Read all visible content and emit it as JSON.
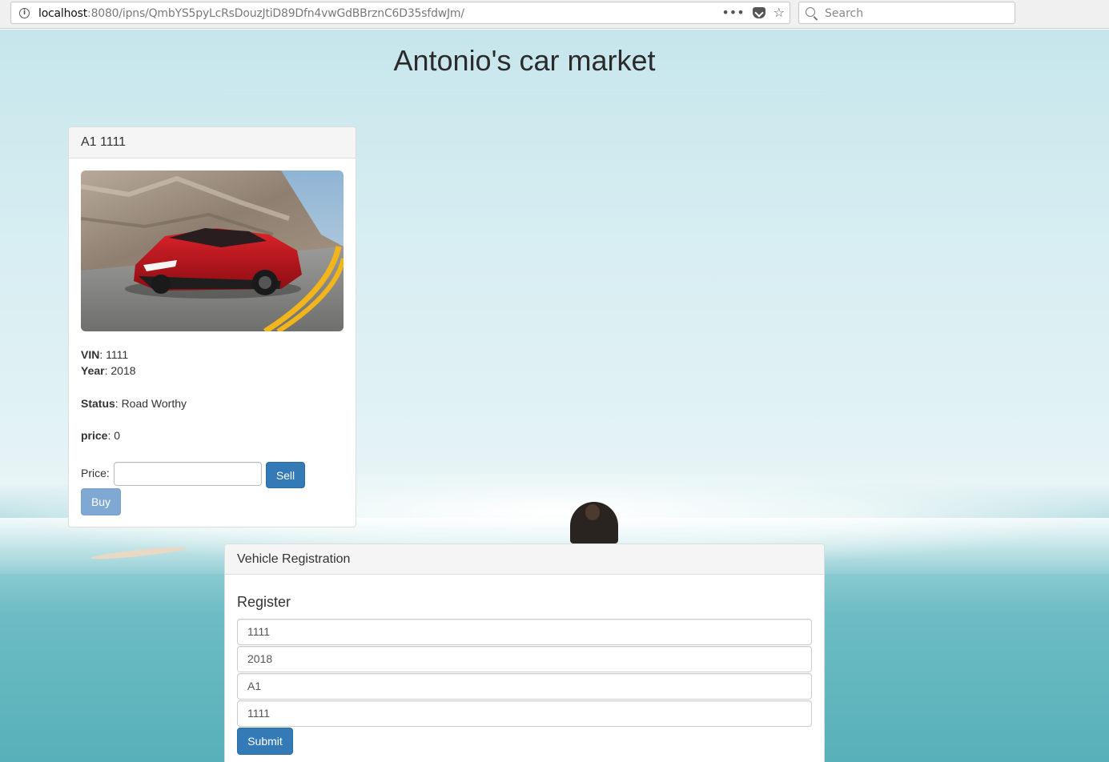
{
  "browser": {
    "url_host": "localhost",
    "url_rest": ":8080/ipns/QmbYS5pyLcRsDouzJtiD89Dfn4vwGdBBrznC6D35sfdwJm/",
    "search_placeholder": "Search",
    "menu_icon_text": "•••",
    "bookmark_icon_text": "☆",
    "info_icon_text": "i"
  },
  "page": {
    "title": "Antonio's car market"
  },
  "car_card": {
    "heading": "A1 1111",
    "vin_label": "VIN",
    "vin_value": ": 1111",
    "year_label": "Year",
    "year_value": ": 2018",
    "status_label": "Status",
    "status_value": ": Road Worthy",
    "price_label": "price",
    "price_value": ": 0",
    "price_input_label": "Price:",
    "price_input_value": "",
    "sell_label": "Sell",
    "buy_label": "Buy"
  },
  "registration": {
    "heading": "Vehicle Registration",
    "title": "Register",
    "fields": [
      "1111",
      "2018",
      "A1",
      "1111"
    ],
    "submit_label": "Submit"
  },
  "colors": {
    "primary": "#337ab7",
    "primary_disabled": "#7fa9d3",
    "panel_heading_bg": "#f5f5f5"
  }
}
